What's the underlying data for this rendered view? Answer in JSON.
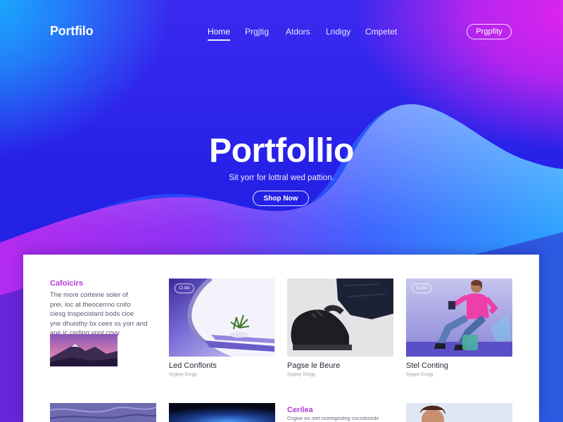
{
  "nav": {
    "logo": "Portfilo",
    "items": [
      {
        "label": "Home",
        "active": true
      },
      {
        "label": "Prgjtig"
      },
      {
        "label": "Atdors"
      },
      {
        "label": "Lndigy"
      },
      {
        "label": "Cmpetet"
      }
    ],
    "button": "Prgpfity"
  },
  "hero": {
    "title": "Portfollio",
    "subtitle": "Sit yorr for lottral wed pattion.",
    "button": "Shop Now"
  },
  "intro": {
    "heading": "Cafoicirs",
    "lines": [
      "The more corteine soler of",
      "prei. loc at theocerrno cnito",
      "ciesg tnspecistard bods cioe",
      "yne dhuisthy bx cees ss yorr and",
      "ane ic ceding ynot covy."
    ],
    "image": "mountain-landscape"
  },
  "cards": [
    {
      "title": "Led Conflonts",
      "meta": "Sygiwy Dsrgg",
      "badge": "Ci dsl",
      "image": "white-curved-stairs-with-plant"
    },
    {
      "title": "Pagse le Beure",
      "meta": "Sygiwy Dsrgg",
      "badge": "",
      "image": "black-sneaker-and-jeans"
    },
    {
      "title": "Stel Conting",
      "meta": "Sygyw Dsrgg",
      "badge": "Ci dsl",
      "image": "woman-in-pink-sweater-sitting"
    }
  ],
  "row2": {
    "heading": "Cerilea",
    "text": "Cngioe inc inet ciceregesting ciscrolsonde"
  },
  "colors": {
    "accent": "#b23bd8",
    "hero_blue": "#2420e6",
    "hero_pink": "#e024ee",
    "hero_cyan": "#16b5ff"
  }
}
